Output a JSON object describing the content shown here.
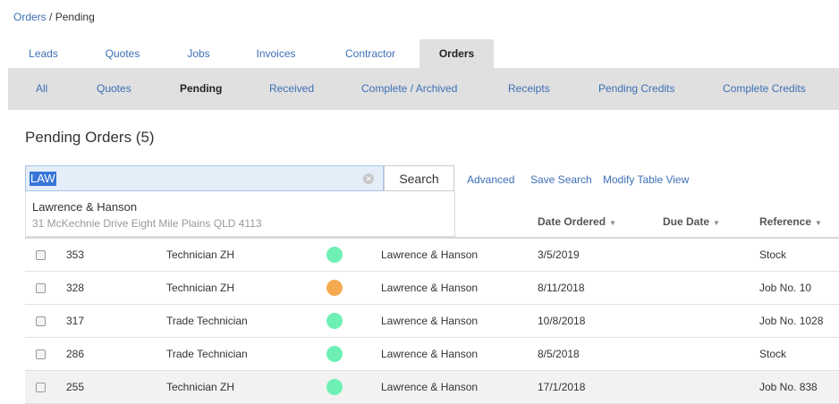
{
  "breadcrumb": {
    "parent": "Orders",
    "separator": "/",
    "current": "Pending"
  },
  "tabs": [
    {
      "label": "Leads"
    },
    {
      "label": "Quotes"
    },
    {
      "label": "Jobs"
    },
    {
      "label": "Invoices"
    },
    {
      "label": "Contractor"
    },
    {
      "label": "Orders",
      "active": true
    }
  ],
  "subnav": [
    {
      "label": "All"
    },
    {
      "label": "Quotes"
    },
    {
      "label": "Pending",
      "active": true
    },
    {
      "label": "Received"
    },
    {
      "label": "Complete / Archived"
    },
    {
      "label": "Receipts"
    },
    {
      "label": "Pending Credits"
    },
    {
      "label": "Complete Credits"
    }
  ],
  "page_title": "Pending Orders (5)",
  "search": {
    "value": "LAW",
    "button_label": "Search",
    "clear_icon": "clear-circle-icon"
  },
  "links": {
    "advanced": "Advanced",
    "save_search": "Save Search",
    "modify_view": "Modify Table View"
  },
  "suggestion": {
    "name": "Lawrence & Hanson",
    "address": "31 McKechnie Drive Eight Mile Plains QLD 4113"
  },
  "columns": {
    "date_ordered": "Date Ordered",
    "due_date": "Due Date",
    "reference": "Reference",
    "sort_icon": "caret-down-icon"
  },
  "colors": {
    "link": "#3d6fb6",
    "status_green": "#6ef0b4",
    "status_orange": "#f5aa52",
    "subnav_bg": "#e0e0e0"
  },
  "rows": [
    {
      "id": "353",
      "staff": "Technician ZH",
      "status": "green",
      "supplier": "Lawrence & Hanson",
      "date_ordered": "3/5/2019",
      "due_date": "",
      "reference": "Stock"
    },
    {
      "id": "328",
      "staff": "Technician ZH",
      "status": "orange",
      "supplier": "Lawrence & Hanson",
      "date_ordered": "8/11/2018",
      "due_date": "",
      "reference": "Job No. 10"
    },
    {
      "id": "317",
      "staff": "Trade Technician",
      "status": "green",
      "supplier": "Lawrence & Hanson",
      "date_ordered": "10/8/2018",
      "due_date": "",
      "reference": "Job No. 1028"
    },
    {
      "id": "286",
      "staff": "Trade Technician",
      "status": "green",
      "supplier": "Lawrence & Hanson",
      "date_ordered": "8/5/2018",
      "due_date": "",
      "reference": "Stock"
    },
    {
      "id": "255",
      "staff": "Technician ZH",
      "status": "green",
      "supplier": "Lawrence & Hanson",
      "date_ordered": "17/1/2018",
      "due_date": "",
      "reference": "Job No. 838"
    }
  ]
}
